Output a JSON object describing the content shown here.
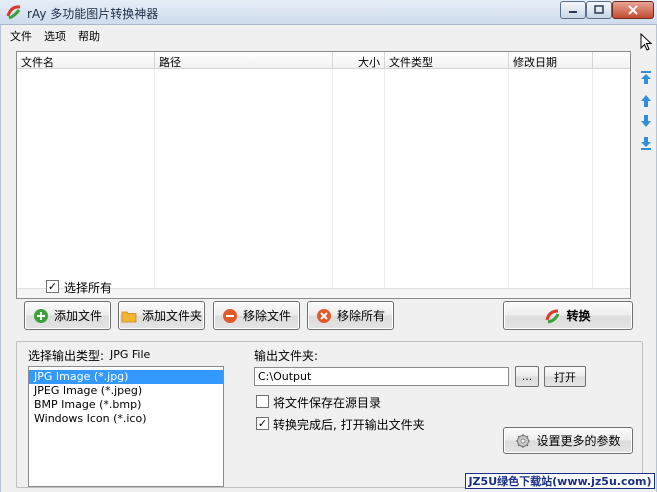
{
  "window": {
    "title": "rAy  多功能图片转换神器",
    "controls": [
      "minimize",
      "maximize",
      "close"
    ]
  },
  "menu": {
    "items": [
      "文件",
      "选项",
      "帮助"
    ]
  },
  "file_list": {
    "columns": [
      "文件名",
      "路径",
      "大小",
      "文件类型",
      "修改日期"
    ],
    "rows": []
  },
  "order_buttons": [
    "move-top-icon",
    "move-up-icon",
    "move-down-icon",
    "move-bottom-icon"
  ],
  "select_all": {
    "label": "选择所有",
    "checked": true
  },
  "actions": {
    "add_file": "添加文件",
    "add_folder": "添加文件夹",
    "remove_file": "移除文件",
    "remove_all": "移除所有",
    "convert": "转换"
  },
  "output": {
    "type_label": "选择输出类型:",
    "type_value": "JPG File",
    "formats": [
      "JPG Image (*.jpg)",
      "JPEG Image (*.jpeg)",
      "BMP Image (*.bmp)",
      "Windows Icon (*.ico)"
    ],
    "selected_format_index": 0,
    "folder_label": "输出文件夹:",
    "folder_path": "C:\\Output",
    "browse_label": "...",
    "open_label": "打开",
    "keep_source_dir": {
      "label": "将文件保存在源目录",
      "checked": false
    },
    "open_after": {
      "label": "转换完成后, 打开输出文件夹",
      "checked": true
    },
    "more_params": "设置更多的参数"
  },
  "watermark": "JZ5U绿色下载站(www.jz5u.com)",
  "colors": {
    "selection": "#3399ff",
    "add_icon": "#3aa23a",
    "remove_icon": "#e05a2a",
    "arrow_icon": "#2f8fd8"
  }
}
